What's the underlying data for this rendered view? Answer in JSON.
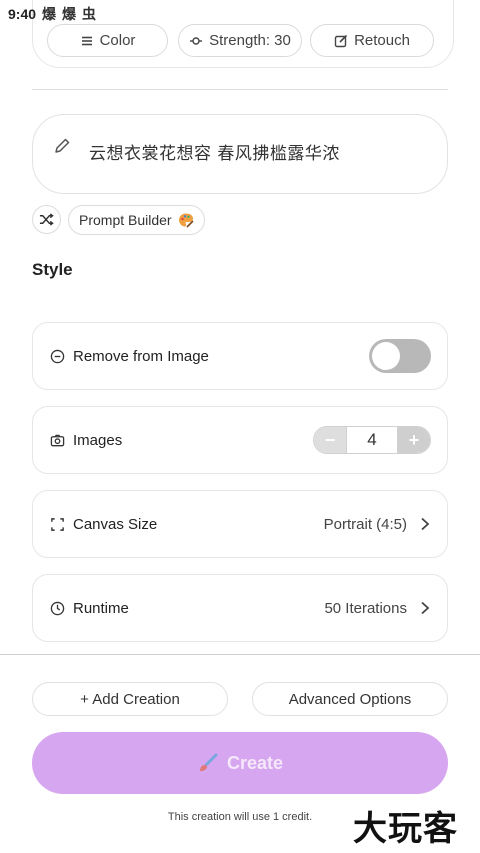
{
  "status_bar": {
    "time": "9:40",
    "icons": [
      "爆",
      "爆",
      "虫"
    ]
  },
  "adjust_chips": [
    {
      "label": "Color",
      "icon": "lines-icon"
    },
    {
      "label": "Strength: 30",
      "icon": "slider-icon"
    },
    {
      "label": "Retouch",
      "icon": "edit-square-icon"
    }
  ],
  "prompt": {
    "text": "云想衣裳花想容 春风拂槛露华浓",
    "icon": "pencil-icon"
  },
  "prompt_tools": {
    "shuffle_icon": "shuffle-icon",
    "builder_label": "Prompt Builder",
    "builder_icon": "palette-icon"
  },
  "style": {
    "title": "Style"
  },
  "settings": {
    "remove": {
      "label": "Remove from Image",
      "icon": "minus-circle-icon",
      "toggle_on": false
    },
    "images": {
      "label": "Images",
      "icon": "camera-icon",
      "count": "4",
      "minus": "−",
      "plus": "+"
    },
    "canvas": {
      "label": "Canvas Size",
      "icon": "frame-corners-icon",
      "value": "Portrait (4:5)"
    },
    "runtime": {
      "label": "Runtime",
      "icon": "clock-icon",
      "value": "50 Iterations"
    }
  },
  "actions": {
    "add_creation": "+ Add Creation",
    "advanced_options": "Advanced Options",
    "create": "Create",
    "credit_note": "This creation will use 1 credit."
  },
  "colors": {
    "create_button": "#d7a6f0",
    "toggle_off": "#b8b8b8"
  },
  "watermark": "大玩客"
}
